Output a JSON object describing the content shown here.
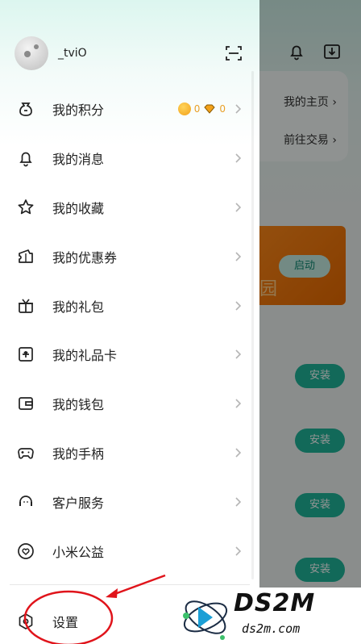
{
  "user": {
    "name": "_tviO"
  },
  "background_app": {
    "links": [
      "我的主页 ›",
      "前往交易 ›"
    ],
    "launch_button": "启动",
    "install_buttons": [
      "安装",
      "安装",
      "安装",
      "安装"
    ],
    "banner_char": "园"
  },
  "points": {
    "coins": "0",
    "gems": "0"
  },
  "menu": [
    {
      "label": "我的积分",
      "icon": "points-bag-icon"
    },
    {
      "label": "我的消息",
      "icon": "bell-icon"
    },
    {
      "label": "我的收藏",
      "icon": "star-icon"
    },
    {
      "label": "我的优惠券",
      "icon": "coupon-icon"
    },
    {
      "label": "我的礼包",
      "icon": "gift-icon"
    },
    {
      "label": "我的礼品卡",
      "icon": "gift-card-icon"
    },
    {
      "label": "我的钱包",
      "icon": "wallet-icon"
    },
    {
      "label": "我的手柄",
      "icon": "gamepad-icon"
    },
    {
      "label": "客户服务",
      "icon": "customer-service-icon"
    },
    {
      "label": "小米公益",
      "icon": "charity-heart-icon"
    }
  ],
  "settings": {
    "label": "设置",
    "icon": "settings-icon"
  },
  "watermark": {
    "main": "DS2M",
    "sub": "ds2m.com"
  },
  "colors": {
    "accent": "#1fb59a",
    "annotation": "#e0141b",
    "coin": "#f2a11a"
  }
}
